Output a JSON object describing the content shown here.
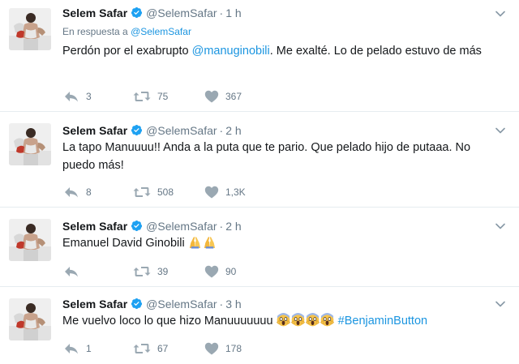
{
  "tweets": [
    {
      "name": "Selem Safar",
      "handle": "@SelemSafar",
      "separator": "·",
      "time": "1 h",
      "reply_prefix": "En respuesta a",
      "reply_to": "@SelemSafar",
      "text_parts": [
        "Perdón por el exabrupto ",
        "@manuginobili",
        ". Me exalté. Lo de pelado estuvo de más"
      ],
      "replies": "3",
      "retweets": "75",
      "likes": "367"
    },
    {
      "name": "Selem Safar",
      "handle": "@SelemSafar",
      "separator": "·",
      "time": "2 h",
      "text": "La tapo Manuuuu!! Anda a la puta que te pario. Que pelado hijo de putaaa. No puedo más!",
      "replies": "8",
      "retweets": "508",
      "likes": "1,3K"
    },
    {
      "name": "Selem Safar",
      "handle": "@SelemSafar",
      "separator": "·",
      "time": "2 h",
      "text": "Emanuel David Ginobili",
      "emoji": [
        "folded-hands",
        "folded-hands"
      ],
      "replies": "",
      "retweets": "39",
      "likes": "90"
    },
    {
      "name": "Selem Safar",
      "handle": "@SelemSafar",
      "separator": "·",
      "time": "3 h",
      "text": "Me vuelvo loco lo que hizo Manuuuuuuu",
      "emoji": [
        "screaming-face",
        "screaming-face",
        "screaming-face",
        "screaming-face"
      ],
      "hashtag": "#BenjaminButton",
      "replies": "1",
      "retweets": "67",
      "likes": "178"
    }
  ],
  "colors": {
    "accent": "#1b95e0",
    "secondary_text": "#657786",
    "divider": "#e6ecf0",
    "verified": "#1da1f2"
  }
}
